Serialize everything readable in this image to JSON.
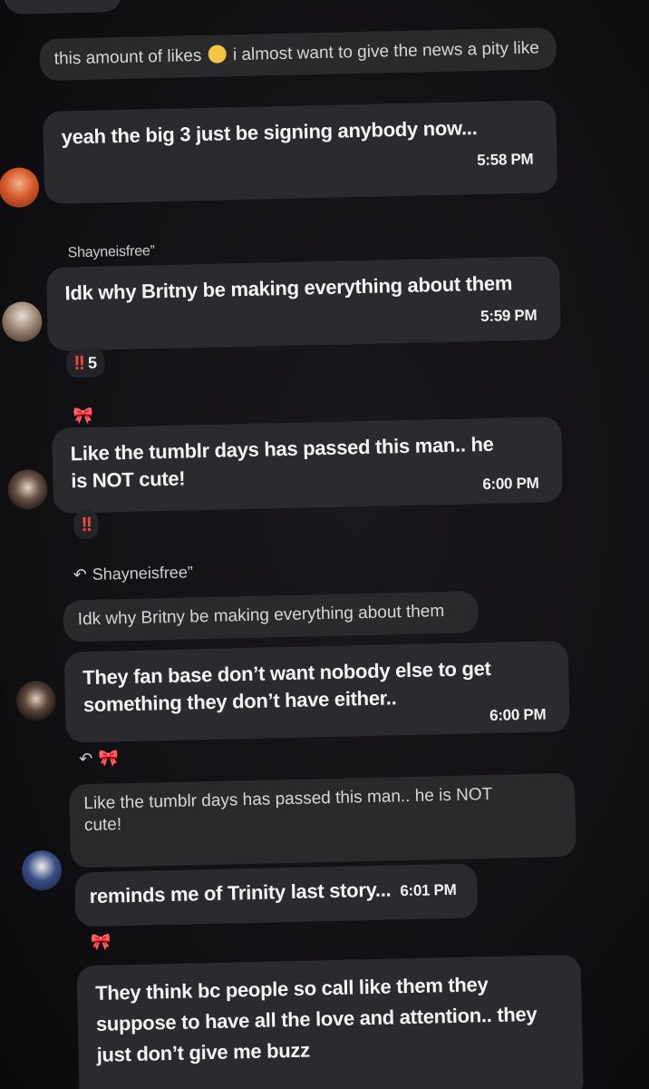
{
  "messages": {
    "m0": {
      "text_before": "this amount of likes",
      "text_after": "i almost want to give the news a pity like"
    },
    "m1": {
      "text": "yeah the big 3 just be signing anybody now...",
      "time": "5:58 PM"
    },
    "m2": {
      "sender": "Shayneisfree”",
      "text": "Idk why Britny be making everything about them",
      "time": "5:59 PM",
      "reaction_mark": "!!",
      "reaction_count": "5"
    },
    "m3": {
      "sender_emoji": "🎀",
      "text": "Like the tumblr days has passed this man.. he is NOT cute!",
      "time": "6:00 PM",
      "reaction_mark": "!!"
    },
    "m4": {
      "reply_to": "Shayneisfree”",
      "quoted": "Idk why Britny be making everything about them",
      "text": "They fan base don’t want nobody else to  get something they don’t have either..",
      "time": "6:00 PM"
    },
    "m5": {
      "reply_to_emoji": "🎀",
      "quoted": "Like the tumblr days has passed this man.. he is NOT cute!",
      "text": "reminds me of Trinity last story...",
      "time": "6:01 PM"
    },
    "m6": {
      "sender_emoji": "🎀",
      "text": "They think bc people so call like them they suppose to have all the love and attention.. they just don’t give me buzz"
    }
  },
  "icons": {
    "reply": "reply-arrow-icon",
    "reaction": "double-exclamation-icon",
    "bow": "pink-bow-emoji",
    "face": "grimacing-face-emoji"
  },
  "colors": {
    "background": "#0e0d10",
    "bubble": "#2b2a2e",
    "reaction_red": "#ea4a3a",
    "bow_pink": "#f06aa8"
  }
}
